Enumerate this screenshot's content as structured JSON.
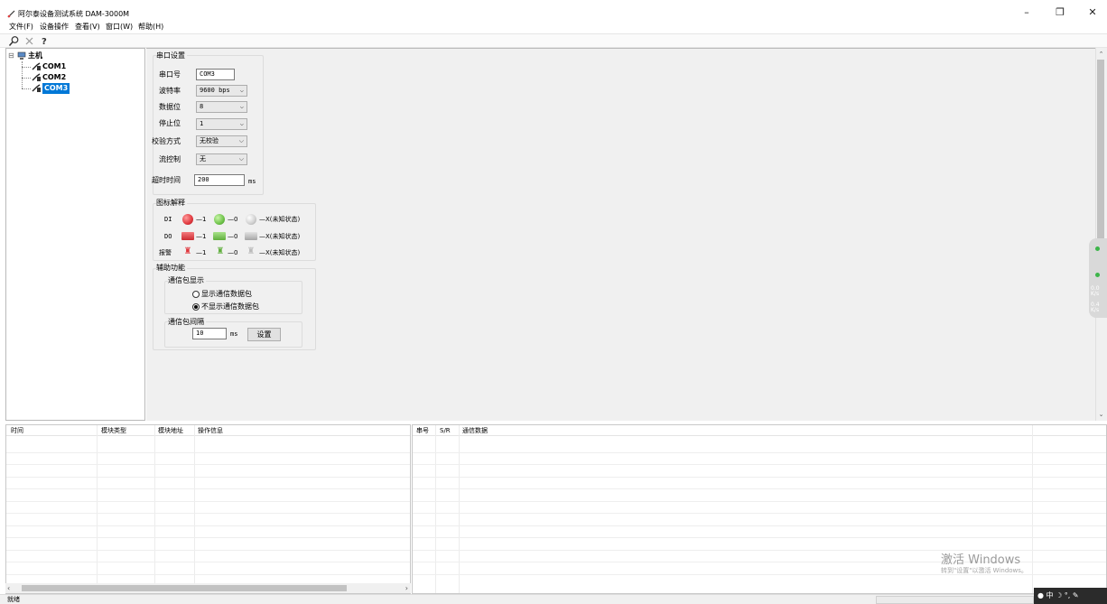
{
  "window": {
    "title": "阿尔泰设备测试系统 DAM-3000M",
    "minimize": "–",
    "maximize": "❐",
    "close": "✕"
  },
  "menu": [
    "文件(F)",
    "设备操作",
    "查看(V)",
    "窗口(W)",
    "帮助(H)"
  ],
  "toolbar": {
    "icons": [
      "search-icon",
      "close-x-icon",
      "help-icon"
    ]
  },
  "tree": {
    "root": "主机",
    "root_toggle": "⊟",
    "items": [
      "COM1",
      "COM2",
      "COM3"
    ],
    "selected": "COM3"
  },
  "serial": {
    "group_title": "串口设置",
    "port_label": "串口号",
    "port_value": "COM3",
    "baud_label": "波特率",
    "baud_value": "9600 bps",
    "data_label": "数据位",
    "data_value": "8",
    "stop_label": "停止位",
    "stop_value": "1",
    "parity_label": "校验方式",
    "parity_value": "无校验",
    "flow_label": "流控制",
    "flow_value": "无",
    "timeout_label": "超时时间",
    "timeout_value": "200",
    "timeout_unit": "ms"
  },
  "legend": {
    "group_title": "图标解释",
    "di_label": "DI",
    "do_label": "DO",
    "alarm_label": "报警",
    "one": "—1",
    "zero": "—0",
    "unknown": "—X(未知状态)",
    "colors": {
      "red": "#e0383e",
      "green": "#6fc34a",
      "gray": "#c8c8c8"
    }
  },
  "aux": {
    "group_title": "辅助功能",
    "packet_display_title": "通信包显示",
    "show_option": "显示通信数据包",
    "hide_option": "不显示通信数据包",
    "selected_option": "hide",
    "interval_title": "通信包间隔",
    "interval_value": "10",
    "interval_unit": "ms",
    "set_button": "设置"
  },
  "side_widget": {
    "rate1": "0.0",
    "rate1_unit": "K/s",
    "rate2": "0.4",
    "rate2_unit": "K/s"
  },
  "log_table": {
    "columns": [
      "时间",
      "模块类型",
      "模块地址",
      "操作信息"
    ]
  },
  "comm_table": {
    "columns": [
      "串号",
      "S/R",
      "通信数据"
    ]
  },
  "status": {
    "text": "就绪"
  },
  "watermark": {
    "line1": "激活 Windows",
    "line2": "转到\"设置\"以激活 Windows。"
  },
  "tray": {
    "text": "● 中 ☽ °, ✎"
  }
}
